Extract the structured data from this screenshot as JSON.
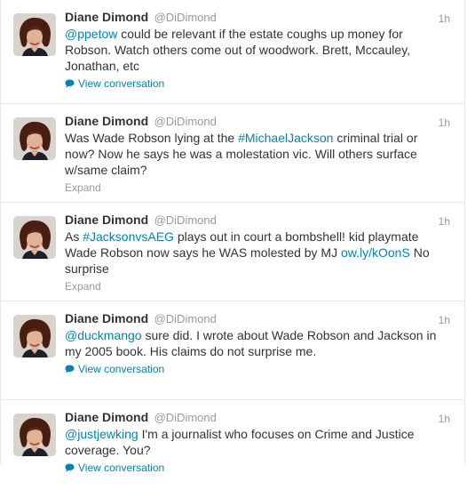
{
  "tweets": [
    {
      "fullname": "Diane Dimond",
      "username": "@DiDimond",
      "time": "1h",
      "segments": [
        {
          "text": "@ppetow",
          "link": true
        },
        {
          "text": " could be relevant if the estate coughs up money for Robson. Watch others come out of woodwork. Brett, Mccauley, Jonathan, etc",
          "link": false
        }
      ],
      "action": "View conversation",
      "action_type": "view"
    },
    {
      "fullname": "Diane Dimond",
      "username": "@DiDimond",
      "time": "1h",
      "segments": [
        {
          "text": "Was Wade Robson lying at the ",
          "link": false
        },
        {
          "text": "#MichaelJackson",
          "link": true
        },
        {
          "text": " criminal trial or now? Now he says he was a molestation vic. Will others surface w/same claim?",
          "link": false
        }
      ],
      "action": "Expand",
      "action_type": "expand"
    },
    {
      "fullname": "Diane Dimond",
      "username": "@DiDimond",
      "time": "1h",
      "segments": [
        {
          "text": "As ",
          "link": false
        },
        {
          "text": "#JacksonvsAEG",
          "link": true
        },
        {
          "text": " plays out in court a bombshell! kid playmate Wade Robson now says he WAS molested by MJ ",
          "link": false
        },
        {
          "text": "ow.ly/kOonS",
          "link": true
        },
        {
          "text": " No surprise",
          "link": false
        }
      ],
      "action": "Expand",
      "action_type": "expand"
    },
    {
      "fullname": "Diane Dimond",
      "username": "@DiDimond",
      "time": "1h",
      "segments": [
        {
          "text": "@duckmango",
          "link": true
        },
        {
          "text": " sure did. I wrote about Wade Robson and Jackson in my 2005 book. His claims do not surprise me.",
          "link": false
        }
      ],
      "action": "View conversation",
      "action_type": "view"
    },
    {
      "fullname": "Diane Dimond",
      "username": "@DiDimond",
      "time": "1h",
      "segments": [
        {
          "text": "@justjewking",
          "link": true
        },
        {
          "text": " I'm a journalist who focuses on Crime and Justice coverage. You?",
          "link": false
        }
      ],
      "action": "View conversation",
      "action_type": "view"
    }
  ],
  "colors": {
    "link": "#0084b4",
    "muted": "#999999",
    "text": "#333333",
    "divider": "#e8e8e8"
  },
  "icons": {
    "conversation": "speech-bubble-icon"
  }
}
